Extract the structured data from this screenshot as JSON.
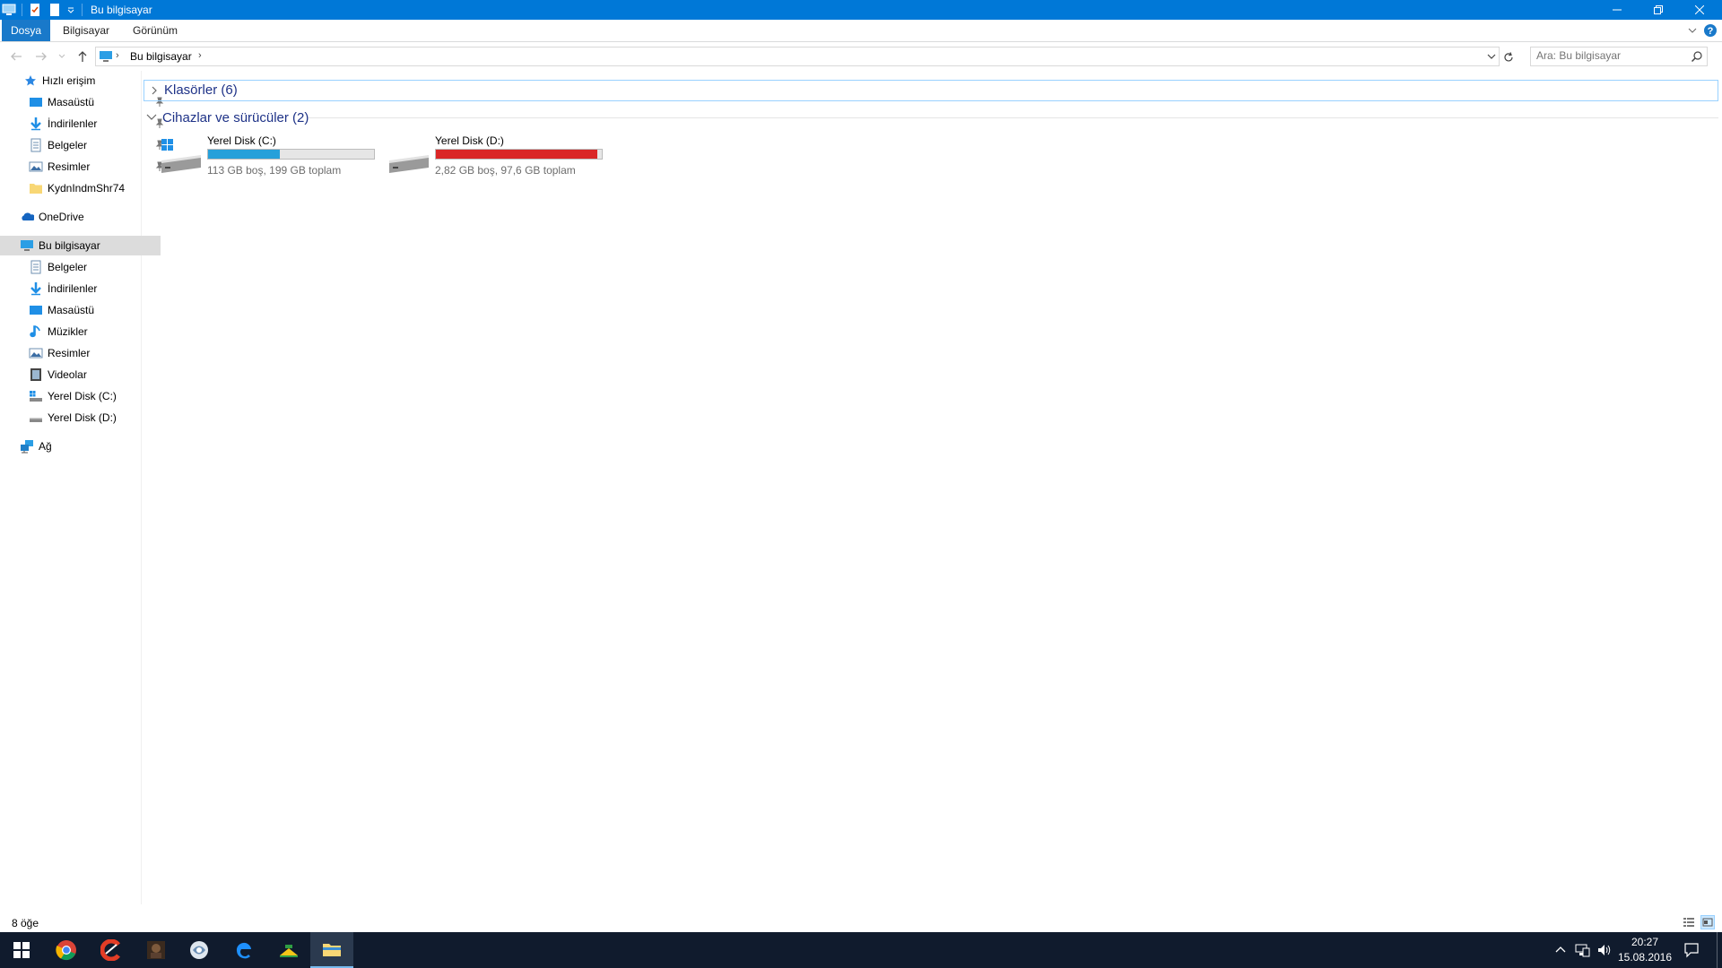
{
  "window": {
    "title": "Bu bilgisayar"
  },
  "ribbon": {
    "tabs": [
      {
        "label": "Dosya"
      },
      {
        "label": "Bilgisayar"
      },
      {
        "label": "Görünüm"
      }
    ]
  },
  "address": {
    "crumb": "Bu bilgisayar",
    "search_placeholder": "Ara: Bu bilgisayar"
  },
  "nav": {
    "quick_access": "Hızlı erişim",
    "quick_items": [
      {
        "label": "Masaüstü",
        "icon": "desktop-icon"
      },
      {
        "label": "İndirilenler",
        "icon": "download-icon"
      },
      {
        "label": "Belgeler",
        "icon": "documents-icon"
      },
      {
        "label": "Resimler",
        "icon": "pictures-icon"
      },
      {
        "label": "KydnIndmShr74",
        "icon": "folder-icon"
      }
    ],
    "onedrive": "OneDrive",
    "this_pc": "Bu bilgisayar",
    "pc_items": [
      {
        "label": "Belgeler",
        "icon": "documents-icon"
      },
      {
        "label": "İndirilenler",
        "icon": "download-icon"
      },
      {
        "label": "Masaüstü",
        "icon": "desktop-icon"
      },
      {
        "label": "Müzikler",
        "icon": "music-icon"
      },
      {
        "label": "Resimler",
        "icon": "pictures-icon"
      },
      {
        "label": "Videolar",
        "icon": "videos-icon"
      },
      {
        "label": "Yerel Disk (C:)",
        "icon": "drive-c-icon"
      },
      {
        "label": "Yerel Disk (D:)",
        "icon": "drive-d-icon"
      }
    ],
    "network": "Ağ"
  },
  "content": {
    "groups": {
      "folders": "Klasörler (6)",
      "devices": "Cihazlar ve sürücüler (2)"
    },
    "drives": [
      {
        "name": "Yerel Disk (C:)",
        "info": "113 GB boş, 199 GB toplam",
        "used_fraction": 0.43,
        "bar_color": "#26a0da"
      },
      {
        "name": "Yerel Disk (D:)",
        "info": "2,82 GB boş, 97,6 GB toplam",
        "used_fraction": 0.971,
        "bar_color": "#da2626"
      }
    ]
  },
  "status": {
    "count": "8 öğe"
  },
  "taskbar": {
    "time": "20:27",
    "date": "15.08.2016"
  },
  "colors": {
    "accent": "#0078d7",
    "group_header": "#1e3287",
    "taskbar": "#101b2d"
  }
}
